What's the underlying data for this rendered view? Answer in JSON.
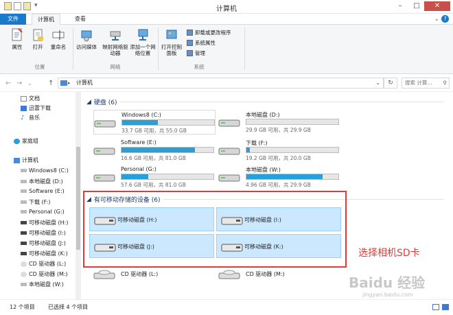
{
  "window": {
    "title": "计算机"
  },
  "tabs": {
    "file": "文件",
    "computer": "计算机",
    "view": "查看"
  },
  "ribbon": {
    "properties": "属性",
    "open": "打开",
    "rename": "重命名",
    "group_location": "位置",
    "access_media": "访问媒体",
    "map_drive": "映射网络驱动器",
    "add_location": "添加一个网络位置",
    "group_network": "网络",
    "open_control_panel": "打开控制面板",
    "uninstall": "卸载或更改程序",
    "system_properties": "系统属性",
    "manage": "管理",
    "group_system": "系统"
  },
  "address": {
    "path": "计算机",
    "search_placeholder": "搜索 计算..."
  },
  "sidebar": {
    "items": [
      "文档",
      "迅雷下载",
      "音乐",
      "家庭组",
      "计算机",
      "Windows8 (C:)",
      "本地磁盘 (D:)",
      "Software (E:)",
      "下载 (F:)",
      "Personal (G:)",
      "可移动磁盘 (H:)",
      "可移动磁盘 (I:)",
      "可移动磁盘 (J:)",
      "可移动磁盘 (K:)",
      "CD 驱动器 (L:)",
      "CD 驱动器 (M:)",
      "本地磁盘 (W:)"
    ]
  },
  "sections": {
    "hdd": "硬盘 (6)",
    "removable": "有可移动存储的设备 (6)"
  },
  "drives": [
    {
      "name": "Windows8 (C:)",
      "size": "33.7 GB 可用，共 55.0 GB",
      "fill": 0.39
    },
    {
      "name": "本地磁盘 (D:)",
      "size": "29.9 GB 可用，共 29.9 GB",
      "fill": 0.0
    },
    {
      "name": "Software (E:)",
      "size": "16.6 GB 可用，共 81.0 GB",
      "fill": 0.8
    },
    {
      "name": "下载 (F:)",
      "size": "19.2 GB 可用，共 20.0 GB",
      "fill": 0.04
    },
    {
      "name": "Personal (G:)",
      "size": "57.6 GB 可用，共 81.0 GB",
      "fill": 0.29
    },
    {
      "name": "本地磁盘 (W:)",
      "size": "4.96 GB 可用，共 29.9 GB",
      "fill": 0.83
    }
  ],
  "removable": [
    "可移动磁盘 (H:)",
    "可移动磁盘 (I:)",
    "可移动磁盘 (J:)",
    "可移动磁盘 (K:)"
  ],
  "cd": [
    "CD 驱动器 (L:)",
    "CD 驱动器 (M:)"
  ],
  "annotation": "选择相机SD卡",
  "status": {
    "count": "12 个项目",
    "selected": "已选择 4 个项目"
  },
  "watermark": {
    "brand": "Baidu 经验",
    "url": "jingyan.baidu.com"
  },
  "colors": {
    "accent": "#1979ca",
    "bar": "#26a0da",
    "selection": "#cce8ff",
    "highlight": "#e53935"
  }
}
